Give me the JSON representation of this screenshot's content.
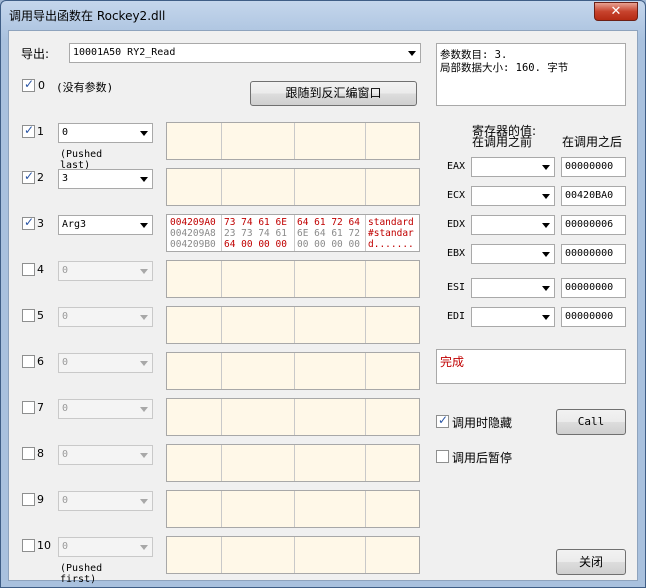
{
  "window": {
    "title": "调用导出函数在 Rockey2.dll",
    "close_glyph": "✕"
  },
  "export": {
    "label": "导出:",
    "selected": "10001A50  RY2_Read"
  },
  "info": {
    "line1": "参数数目: 3.",
    "line2": "局部数据大小: 160. 字节"
  },
  "param0": {
    "checkbox_label": "0",
    "note": "(没有参数)",
    "checked": true
  },
  "follow_button": "跟随到反汇编窗口",
  "params": [
    {
      "num": "1",
      "checked": true,
      "value": "0",
      "note": "(Pushed last)",
      "enabled": true
    },
    {
      "num": "2",
      "checked": true,
      "value": "3",
      "note": "",
      "enabled": true
    },
    {
      "num": "3",
      "checked": true,
      "value": "Arg3",
      "note": "",
      "enabled": true
    },
    {
      "num": "4",
      "checked": false,
      "value": "0",
      "note": "",
      "enabled": false
    },
    {
      "num": "5",
      "checked": false,
      "value": "0",
      "note": "",
      "enabled": false
    },
    {
      "num": "6",
      "checked": false,
      "value": "0",
      "note": "",
      "enabled": false
    },
    {
      "num": "7",
      "checked": false,
      "value": "0",
      "note": "",
      "enabled": false
    },
    {
      "num": "8",
      "checked": false,
      "value": "0",
      "note": "",
      "enabled": false
    },
    {
      "num": "9",
      "checked": false,
      "value": "0",
      "note": "",
      "enabled": false
    },
    {
      "num": "10",
      "checked": false,
      "value": "0",
      "note": "(Pushed first)",
      "enabled": false
    }
  ],
  "memdump": {
    "rows": [
      {
        "addr": "004209A0",
        "hex1": "73 74 61 6E",
        "hex2": "64 61 72 64",
        "ascii": "standard"
      },
      {
        "addr": "004209A8",
        "hex1": "23 73 74 61",
        "hex2": "6E 64 61 72",
        "ascii": "#standar"
      },
      {
        "addr": "004209B0",
        "hex1": "64 00 00 00",
        "hex2": "00 00 00 00",
        "ascii": "d......."
      }
    ]
  },
  "registers": {
    "header": "寄存器的值:",
    "before_label": "在调用之前",
    "after_label": "在调用之后",
    "items": [
      {
        "name": "EAX",
        "after": "00000000"
      },
      {
        "name": "ECX",
        "after": "00420BA0"
      },
      {
        "name": "EDX",
        "after": "00000006"
      },
      {
        "name": "EBX",
        "after": "00000000"
      },
      {
        "name": "ESI",
        "after": "00000000"
      },
      {
        "name": "EDI",
        "after": "00000000"
      }
    ]
  },
  "status": {
    "text": "完成",
    "color": "#c00000"
  },
  "options": {
    "hide_label": "调用时隐藏",
    "hide_checked": true,
    "pause_label": "调用后暂停",
    "pause_checked": false
  },
  "buttons": {
    "call": "Call",
    "close": "关闭"
  },
  "colors": {
    "memory_text": "#c00000",
    "memory_faded": "#8a8a8a"
  }
}
